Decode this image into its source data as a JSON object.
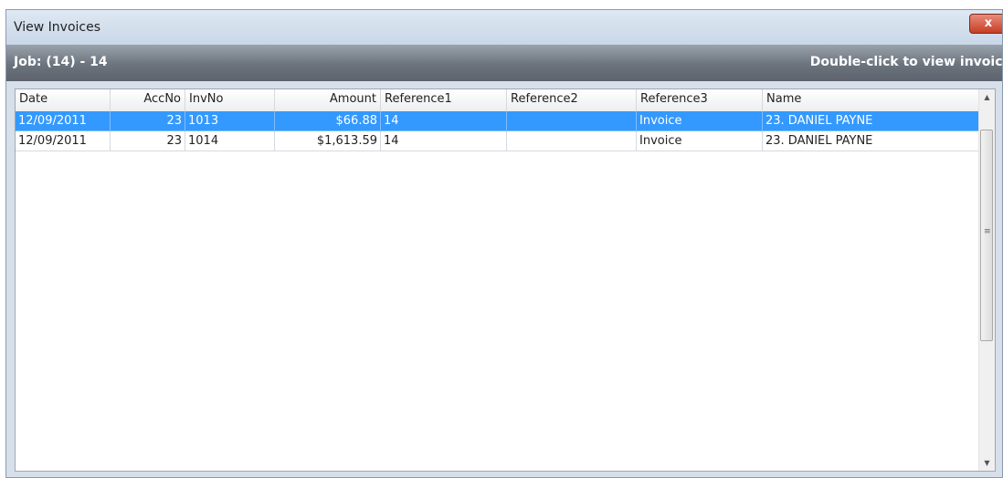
{
  "window": {
    "title": "View Invoices",
    "close_label": "x"
  },
  "jobbar": {
    "title": "Job: (14) - 14",
    "hint": "Double-click to view invoice"
  },
  "table": {
    "columns": [
      "Date",
      "AccNo",
      "InvNo",
      "Amount",
      "Reference1",
      "Reference2",
      "Reference3",
      "Name"
    ],
    "rows": [
      {
        "selected": true,
        "cells": [
          "12/09/2011",
          "23",
          "1013",
          "$66.88",
          "14",
          "",
          "Invoice",
          "23. DANIEL PAYNE"
        ]
      },
      {
        "selected": false,
        "cells": [
          "12/09/2011",
          "23",
          "1014",
          "$1,613.59",
          "14",
          "",
          "Invoice",
          "23. DANIEL PAYNE"
        ]
      }
    ]
  },
  "scrollbar": {
    "up_icon": "triangle-up-icon",
    "down_icon": "triangle-down-icon"
  },
  "colors": {
    "selection": "#3399ff",
    "jobbar": "#6b737d",
    "close": "#c63d25"
  }
}
